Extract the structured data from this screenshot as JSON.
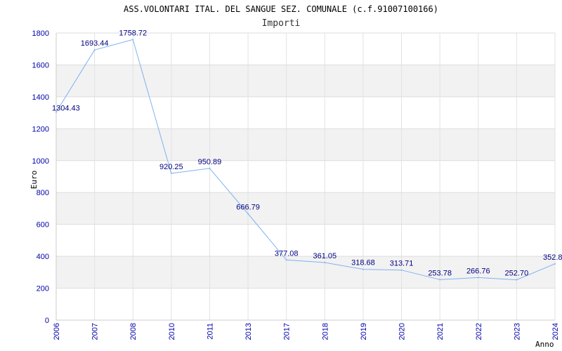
{
  "chart_data": {
    "type": "line",
    "title": "ASS.VOLONTARI ITAL. DEL SANGUE SEZ. COMUNALE (c.f.91007100166)",
    "subtitle": "Importi",
    "xlabel": "Anno",
    "ylabel": "Euro",
    "categories": [
      "2006",
      "2007",
      "2008",
      "2010",
      "2011",
      "2013",
      "2017",
      "2018",
      "2019",
      "2020",
      "2021",
      "2022",
      "2023",
      "2024"
    ],
    "series": [
      {
        "values": [
          1304.43,
          1693.44,
          1758.72,
          920.25,
          950.89,
          666.79,
          377.08,
          361.05,
          318.68,
          313.71,
          253.78,
          266.76,
          252.7,
          352.8
        ],
        "labels": [
          "1304.43",
          "1693.44",
          "1758.72",
          "920.25",
          "950.89",
          "666.79",
          "377.08",
          "361.05",
          "318.68",
          "313.71",
          "253.78",
          "266.76",
          "252.70",
          "352.8"
        ]
      }
    ],
    "ylim": [
      0,
      1800
    ],
    "yticks": [
      "0",
      "200",
      "400",
      "600",
      "800",
      "1000",
      "1200",
      "1400",
      "1600",
      "1800"
    ],
    "grid": true,
    "colors": {
      "line": "#7fb2f0",
      "tick_text": "#0000aa",
      "label_text": "#000080",
      "band": "#f2f2f2",
      "grid": "#dddddd"
    }
  }
}
